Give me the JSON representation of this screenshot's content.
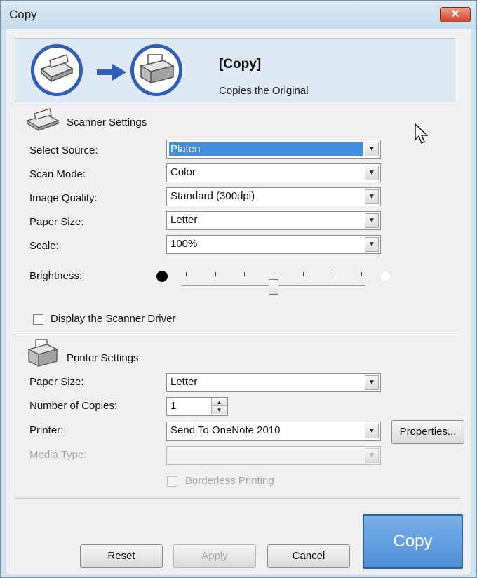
{
  "window": {
    "title": "Copy",
    "close_glyph": "✕"
  },
  "banner": {
    "title": "[Copy]",
    "description": "Copies the Original",
    "arrow_icon": "arrow-right-icon"
  },
  "scanner": {
    "section_title": "Scanner Settings",
    "select_source_label": "Select Source:",
    "select_source_value": "Platen",
    "scan_mode_label": "Scan Mode:",
    "scan_mode_value": "Color",
    "image_quality_label": "Image Quality:",
    "image_quality_value": "Standard (300dpi)",
    "paper_size_label": "Paper Size:",
    "paper_size_value": "Letter",
    "scale_label": "Scale:",
    "scale_value": "100%",
    "brightness_label": "Brightness:",
    "brightness_level": 0.5,
    "brightness_ticks": 7,
    "display_driver_label": "Display the Scanner Driver",
    "display_driver_checked": false
  },
  "printer": {
    "section_title": "Printer Settings",
    "paper_size_label": "Paper Size:",
    "paper_size_value": "Letter",
    "copies_label": "Number of Copies:",
    "copies_value": "1",
    "printer_label": "Printer:",
    "printer_value": "Send To OneNote 2010",
    "properties_label": "Properties...",
    "media_type_label": "Media Type:",
    "media_type_value": "",
    "borderless_label": "Borderless Printing",
    "borderless_checked": false
  },
  "footer": {
    "reset_label": "Reset",
    "apply_label": "Apply",
    "cancel_label": "Cancel",
    "copy_label": "Copy"
  },
  "colors": {
    "accent": "#2f5fb8",
    "copy_button": "#5b98dc",
    "selection": "#3f8fe0"
  }
}
